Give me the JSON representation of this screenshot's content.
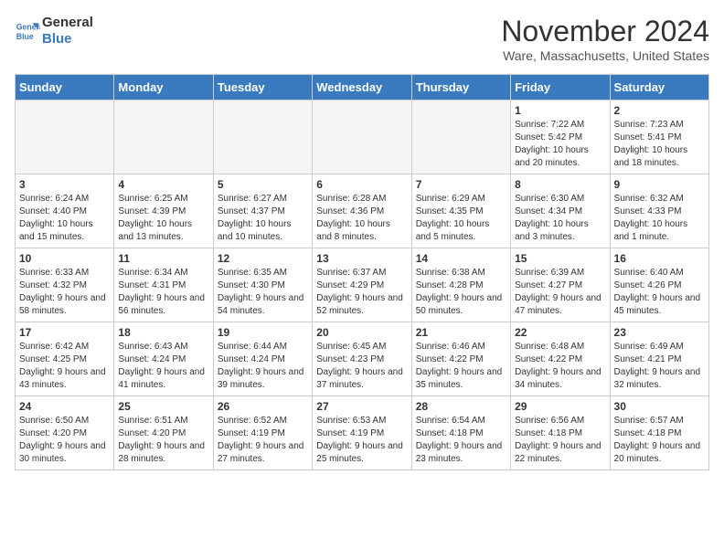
{
  "logo": {
    "line1": "General",
    "line2": "Blue"
  },
  "title": "November 2024",
  "location": "Ware, Massachusetts, United States",
  "days_of_week": [
    "Sunday",
    "Monday",
    "Tuesday",
    "Wednesday",
    "Thursday",
    "Friday",
    "Saturday"
  ],
  "weeks": [
    [
      {
        "day": "",
        "info": ""
      },
      {
        "day": "",
        "info": ""
      },
      {
        "day": "",
        "info": ""
      },
      {
        "day": "",
        "info": ""
      },
      {
        "day": "",
        "info": ""
      },
      {
        "day": "1",
        "info": "Sunrise: 7:22 AM\nSunset: 5:42 PM\nDaylight: 10 hours and 20 minutes."
      },
      {
        "day": "2",
        "info": "Sunrise: 7:23 AM\nSunset: 5:41 PM\nDaylight: 10 hours and 18 minutes."
      }
    ],
    [
      {
        "day": "3",
        "info": "Sunrise: 6:24 AM\nSunset: 4:40 PM\nDaylight: 10 hours and 15 minutes."
      },
      {
        "day": "4",
        "info": "Sunrise: 6:25 AM\nSunset: 4:39 PM\nDaylight: 10 hours and 13 minutes."
      },
      {
        "day": "5",
        "info": "Sunrise: 6:27 AM\nSunset: 4:37 PM\nDaylight: 10 hours and 10 minutes."
      },
      {
        "day": "6",
        "info": "Sunrise: 6:28 AM\nSunset: 4:36 PM\nDaylight: 10 hours and 8 minutes."
      },
      {
        "day": "7",
        "info": "Sunrise: 6:29 AM\nSunset: 4:35 PM\nDaylight: 10 hours and 5 minutes."
      },
      {
        "day": "8",
        "info": "Sunrise: 6:30 AM\nSunset: 4:34 PM\nDaylight: 10 hours and 3 minutes."
      },
      {
        "day": "9",
        "info": "Sunrise: 6:32 AM\nSunset: 4:33 PM\nDaylight: 10 hours and 1 minute."
      }
    ],
    [
      {
        "day": "10",
        "info": "Sunrise: 6:33 AM\nSunset: 4:32 PM\nDaylight: 9 hours and 58 minutes."
      },
      {
        "day": "11",
        "info": "Sunrise: 6:34 AM\nSunset: 4:31 PM\nDaylight: 9 hours and 56 minutes."
      },
      {
        "day": "12",
        "info": "Sunrise: 6:35 AM\nSunset: 4:30 PM\nDaylight: 9 hours and 54 minutes."
      },
      {
        "day": "13",
        "info": "Sunrise: 6:37 AM\nSunset: 4:29 PM\nDaylight: 9 hours and 52 minutes."
      },
      {
        "day": "14",
        "info": "Sunrise: 6:38 AM\nSunset: 4:28 PM\nDaylight: 9 hours and 50 minutes."
      },
      {
        "day": "15",
        "info": "Sunrise: 6:39 AM\nSunset: 4:27 PM\nDaylight: 9 hours and 47 minutes."
      },
      {
        "day": "16",
        "info": "Sunrise: 6:40 AM\nSunset: 4:26 PM\nDaylight: 9 hours and 45 minutes."
      }
    ],
    [
      {
        "day": "17",
        "info": "Sunrise: 6:42 AM\nSunset: 4:25 PM\nDaylight: 9 hours and 43 minutes."
      },
      {
        "day": "18",
        "info": "Sunrise: 6:43 AM\nSunset: 4:24 PM\nDaylight: 9 hours and 41 minutes."
      },
      {
        "day": "19",
        "info": "Sunrise: 6:44 AM\nSunset: 4:24 PM\nDaylight: 9 hours and 39 minutes."
      },
      {
        "day": "20",
        "info": "Sunrise: 6:45 AM\nSunset: 4:23 PM\nDaylight: 9 hours and 37 minutes."
      },
      {
        "day": "21",
        "info": "Sunrise: 6:46 AM\nSunset: 4:22 PM\nDaylight: 9 hours and 35 minutes."
      },
      {
        "day": "22",
        "info": "Sunrise: 6:48 AM\nSunset: 4:22 PM\nDaylight: 9 hours and 34 minutes."
      },
      {
        "day": "23",
        "info": "Sunrise: 6:49 AM\nSunset: 4:21 PM\nDaylight: 9 hours and 32 minutes."
      }
    ],
    [
      {
        "day": "24",
        "info": "Sunrise: 6:50 AM\nSunset: 4:20 PM\nDaylight: 9 hours and 30 minutes."
      },
      {
        "day": "25",
        "info": "Sunrise: 6:51 AM\nSunset: 4:20 PM\nDaylight: 9 hours and 28 minutes."
      },
      {
        "day": "26",
        "info": "Sunrise: 6:52 AM\nSunset: 4:19 PM\nDaylight: 9 hours and 27 minutes."
      },
      {
        "day": "27",
        "info": "Sunrise: 6:53 AM\nSunset: 4:19 PM\nDaylight: 9 hours and 25 minutes."
      },
      {
        "day": "28",
        "info": "Sunrise: 6:54 AM\nSunset: 4:18 PM\nDaylight: 9 hours and 23 minutes."
      },
      {
        "day": "29",
        "info": "Sunrise: 6:56 AM\nSunset: 4:18 PM\nDaylight: 9 hours and 22 minutes."
      },
      {
        "day": "30",
        "info": "Sunrise: 6:57 AM\nSunset: 4:18 PM\nDaylight: 9 hours and 20 minutes."
      }
    ]
  ]
}
